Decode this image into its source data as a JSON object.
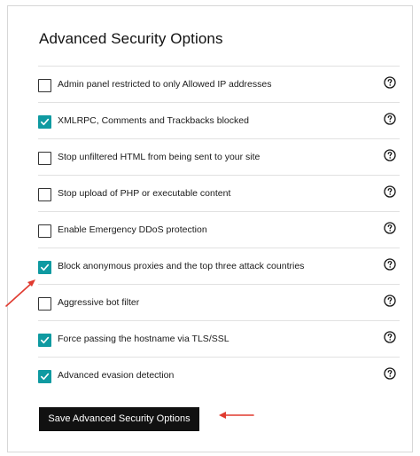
{
  "panel": {
    "title": "Advanced Security Options",
    "save_label": "Save Advanced Security Options"
  },
  "options": [
    {
      "label": "Admin panel restricted to only Allowed IP addresses",
      "checked": false
    },
    {
      "label": "XMLRPC, Comments and Trackbacks blocked",
      "checked": true
    },
    {
      "label": "Stop unfiltered HTML from being sent to your site",
      "checked": false
    },
    {
      "label": "Stop upload of PHP or executable content",
      "checked": false
    },
    {
      "label": "Enable Emergency DDoS protection",
      "checked": false
    },
    {
      "label": "Block anonymous proxies and the top three attack countries",
      "checked": true
    },
    {
      "label": "Aggressive bot filter",
      "checked": false
    },
    {
      "label": "Force passing the hostname via TLS/SSL",
      "checked": true
    },
    {
      "label": "Advanced evasion detection",
      "checked": true
    }
  ],
  "icons": {
    "help": "question-circle-icon",
    "check": "checkmark-icon",
    "annotation_arrow": "red-arrow-annotation"
  },
  "colors": {
    "checked_fill": "#0f9aa1",
    "button_bg": "#111111",
    "annotation": "#e03a2f"
  }
}
